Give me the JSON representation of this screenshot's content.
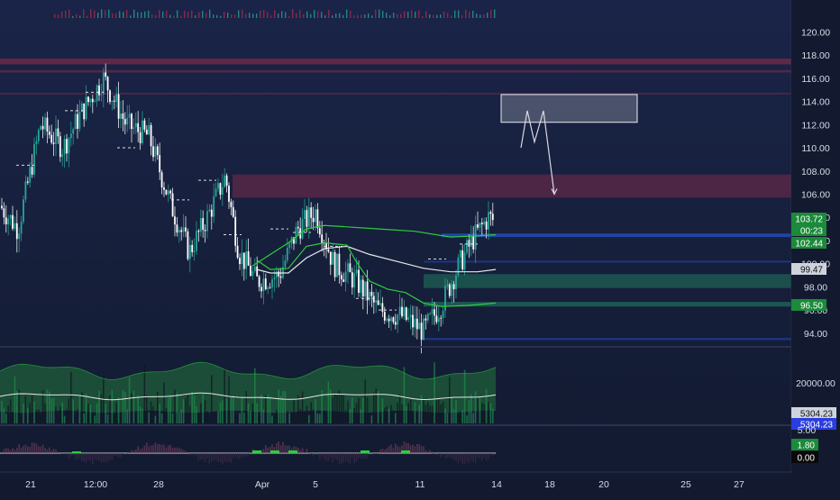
{
  "colors": {
    "background": "#1b2447",
    "candle_up": "#26a69a",
    "candle_down": "#ffffff",
    "ema_green": "#2ecc40",
    "ema_white": "#e8e8e8",
    "resistance_zone": "#7a2a4a",
    "support_zone": "#1f6f5a",
    "blue_line": "#2962ff",
    "badge_green": "#1b8a3a",
    "badge_gray": "#cfd3dc",
    "badge_blue": "#2a3de0",
    "badge_dark": "#0a0a0a"
  },
  "price_axis": {
    "ticks": [
      "120.00",
      "118.00",
      "116.00",
      "114.00",
      "112.00",
      "110.00",
      "108.00",
      "106.00",
      "104.00",
      "102.00",
      "100.00",
      "98.00",
      "96.00",
      "94.00"
    ],
    "badges": [
      {
        "label": "103.72",
        "value": 103.72,
        "kind": "green"
      },
      {
        "label": "00:23",
        "value": 102.95,
        "kind": "green"
      },
      {
        "label": "102.44",
        "value": 102.44,
        "kind": "green"
      },
      {
        "label": "99.47",
        "value": 99.47,
        "kind": "gray"
      },
      {
        "label": "96.50",
        "value": 96.5,
        "kind": "green"
      }
    ]
  },
  "volume_axis": {
    "ticks": [
      "20000.00"
    ],
    "badges": [
      {
        "label": "5304.23",
        "kind": "gray"
      },
      {
        "label": "5304.23",
        "kind": "blue"
      }
    ]
  },
  "osc_axis": {
    "ticks": [
      "5.00"
    ],
    "badges": [
      {
        "label": "1.80",
        "kind": "green"
      },
      {
        "label": "0.00",
        "kind": "dark"
      }
    ]
  },
  "time_axis": {
    "labels": [
      "21",
      "12:00",
      "28",
      "Apr",
      "5",
      "11",
      "14",
      "18",
      "20",
      "25",
      "27"
    ]
  },
  "chart_data": {
    "type": "candlestick",
    "symbol_timeframe": "",
    "price_ylim": [
      92.9,
      121.2
    ],
    "zones": [
      {
        "name": "resistance-upper",
        "from": 117.2,
        "to": 117.7
      },
      {
        "name": "resistance-upper-2",
        "from": 116.5,
        "to": 116.7
      },
      {
        "name": "resistance-main",
        "from": 105.7,
        "to": 107.7
      },
      {
        "name": "resistance-thin",
        "from": 114.6,
        "to": 114.75
      },
      {
        "name": "support-102",
        "from": 102.3,
        "to": 102.6
      },
      {
        "name": "support-100",
        "from": 100.1,
        "to": 100.25
      },
      {
        "name": "support-98",
        "from": 97.9,
        "to": 99.1
      },
      {
        "name": "support-96",
        "from": 96.3,
        "to": 96.7
      },
      {
        "name": "support-94",
        "from": 93.4,
        "to": 93.6
      }
    ],
    "projection_box": {
      "from": 112.2,
      "to": 114.6
    },
    "projection_path": [
      110.0,
      113.2,
      110.5,
      113.2,
      106.0
    ],
    "last_price": 103.72
  }
}
